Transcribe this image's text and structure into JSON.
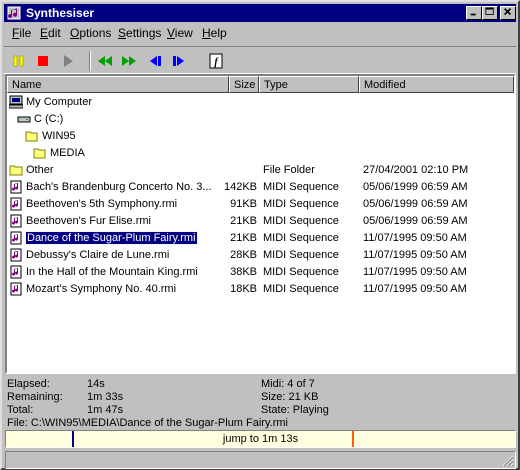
{
  "window": {
    "title": "Synthesiser"
  },
  "menu": [
    {
      "label": "File",
      "hotkey": "F",
      "rest": "ile"
    },
    {
      "label": "Edit",
      "hotkey": "E",
      "rest": "dit"
    },
    {
      "label": "Options",
      "hotkey": "O",
      "rest": "ptions"
    },
    {
      "label": "Settings",
      "hotkey": "S",
      "rest": "ettings"
    },
    {
      "label": "View",
      "hotkey": "V",
      "rest": "iew"
    },
    {
      "label": "Help",
      "hotkey": "H",
      "rest": "elp"
    }
  ],
  "toolbar": {
    "pause": "pause-icon",
    "stop": "stop-icon",
    "play": "play-icon",
    "rewind": "rewind-icon",
    "fastforward": "fast-forward-icon",
    "prev": "previous-track-icon",
    "next": "next-track-icon",
    "info": "info-icon"
  },
  "columns": {
    "name": "Name",
    "size": "Size",
    "type": "Type",
    "modified": "Modified"
  },
  "tree": {
    "computer": "My Computer",
    "drive": "C (C:)",
    "win95": "WIN95",
    "media": "MEDIA"
  },
  "files": [
    {
      "name": "Other",
      "size": "",
      "type": "File Folder",
      "modified": "27/04/2001 02:10 PM",
      "icon": "folder",
      "selected": false
    },
    {
      "name": "Bach's Brandenburg Concerto No. 3...",
      "size": "142KB",
      "type": "MIDI Sequence",
      "modified": "05/06/1999 06:59 AM",
      "icon": "midi",
      "selected": false
    },
    {
      "name": "Beethoven's 5th Symphony.rmi",
      "size": "91KB",
      "type": "MIDI Sequence",
      "modified": "05/06/1999 06:59 AM",
      "icon": "midi",
      "selected": false
    },
    {
      "name": "Beethoven's Fur Elise.rmi",
      "size": "21KB",
      "type": "MIDI Sequence",
      "modified": "05/06/1999 06:59 AM",
      "icon": "midi",
      "selected": false
    },
    {
      "name": "Dance of the Sugar-Plum Fairy.rmi",
      "size": "21KB",
      "type": "MIDI Sequence",
      "modified": "11/07/1995 09:50 AM",
      "icon": "midi",
      "selected": true
    },
    {
      "name": "Debussy's Claire de Lune.rmi",
      "size": "28KB",
      "type": "MIDI Sequence",
      "modified": "11/07/1995 09:50 AM",
      "icon": "midi",
      "selected": false
    },
    {
      "name": "In the Hall of the Mountain King.rmi",
      "size": "38KB",
      "type": "MIDI Sequence",
      "modified": "11/07/1995 09:50 AM",
      "icon": "midi",
      "selected": false
    },
    {
      "name": "Mozart's Symphony No. 40.rmi",
      "size": "18KB",
      "type": "MIDI Sequence",
      "modified": "11/07/1995 09:50 AM",
      "icon": "midi",
      "selected": false
    }
  ],
  "status": {
    "elapsed_label": "Elapsed:",
    "elapsed": "14s",
    "remaining_label": "Remaining:",
    "remaining": "1m 33s",
    "total_label": "Total:",
    "total": "1m 47s",
    "midi": "Midi: 4 of 7",
    "size": "Size: 21 KB",
    "state": "State: Playing",
    "file": "File: C:\\WIN95\\MEDIA\\Dance of the Sugar-Plum Fairy.rmi"
  },
  "jump": {
    "text": "jump to 1m 13s",
    "position_fraction": 0.68,
    "played_fraction": 0.13
  },
  "colors": {
    "titlebar": "#000080",
    "selection": "#000080",
    "jumpbar_bg": "#ffffe0"
  }
}
